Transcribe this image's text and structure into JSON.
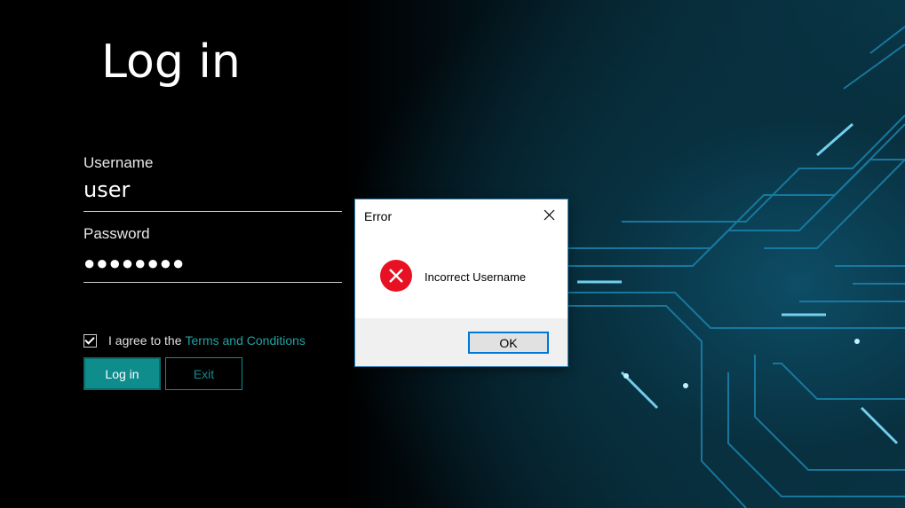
{
  "login": {
    "title": "Log in",
    "username_label": "Username",
    "username_value": "user",
    "password_label": "Password",
    "password_value": "●●●●●●●●",
    "agree_text": "I agree to the",
    "terms_link": "Terms and Conditions",
    "login_button": "Log in",
    "exit_button": "Exit",
    "agree_checked": true
  },
  "dialog": {
    "title": "Error",
    "message": "Incorrect Username",
    "ok_label": "OK",
    "icon": "error-icon"
  },
  "colors": {
    "accent": "#0f8c8c",
    "link": "#1fa3a3",
    "error_red": "#e81123",
    "ok_border": "#0078d7"
  }
}
